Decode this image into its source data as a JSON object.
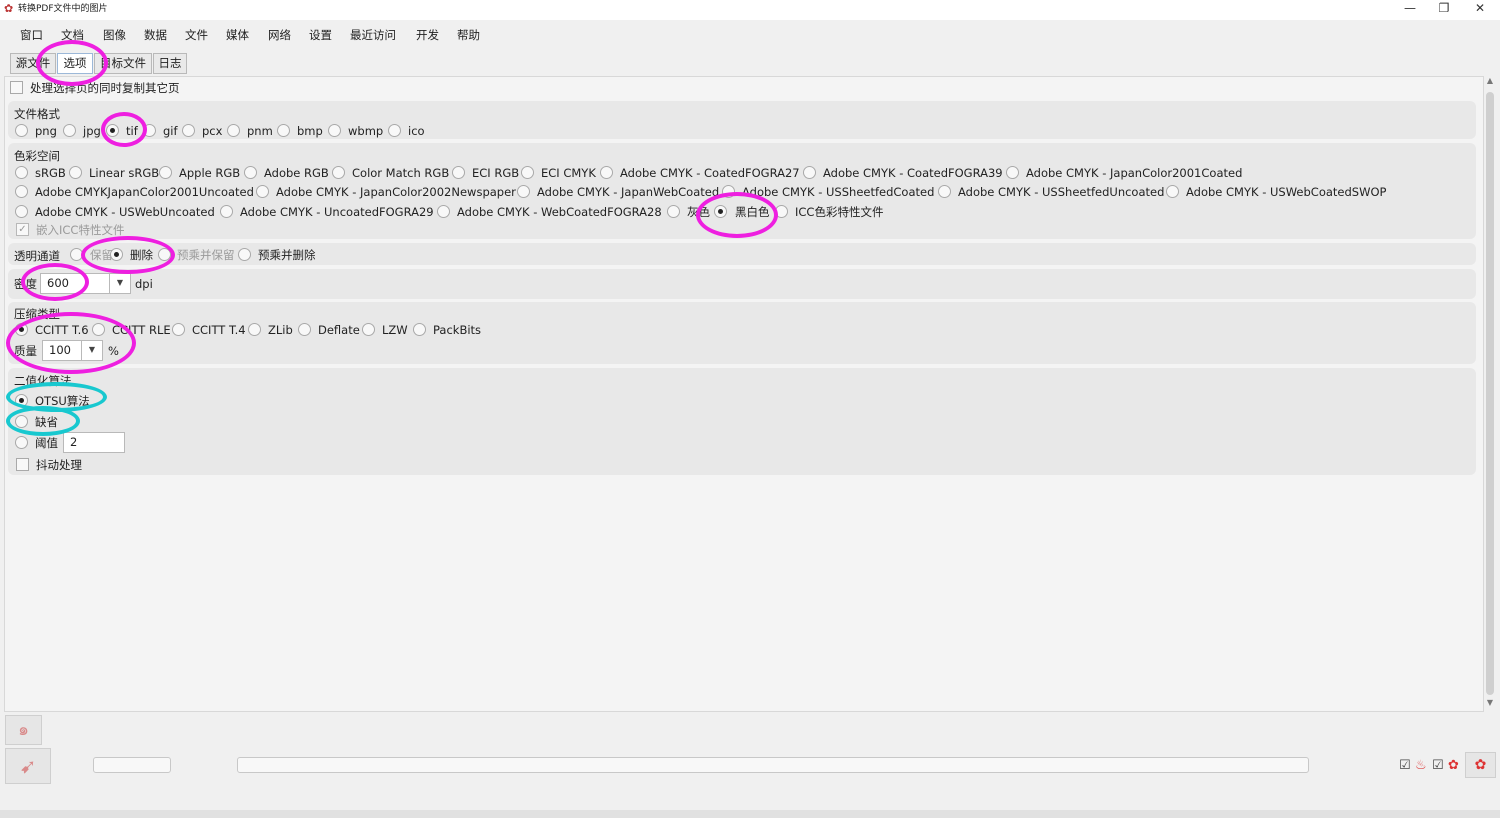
{
  "window": {
    "title": "转换PDF文件中的图片",
    "app_icon": "app-logo-icon",
    "controls": {
      "minimize": "—",
      "restore": "❐",
      "close": "✕"
    }
  },
  "menubar": [
    "窗口",
    "文档",
    "图像",
    "数据",
    "文件",
    "媒体",
    "网络",
    "设置",
    "最近访问",
    "开发",
    "帮助"
  ],
  "tabs": [
    "源文件",
    "选项",
    "目标文件",
    "日志"
  ],
  "active_tab": "选项",
  "options": {
    "copy_others": {
      "label": "处理选择页的同时复制其它页",
      "checked": false
    },
    "file_format": {
      "title": "文件格式",
      "options": [
        "png",
        "jpg",
        "tif",
        "gif",
        "pcx",
        "pnm",
        "bmp",
        "wbmp",
        "ico"
      ],
      "selected": "tif"
    },
    "color_space": {
      "title": "色彩空间",
      "row1": [
        "sRGB",
        "Linear sRGB",
        "Apple RGB",
        "Adobe RGB",
        "Color Match RGB",
        "ECI RGB",
        "ECI CMYK",
        "Adobe CMYK - CoatedFOGRA27",
        "Adobe CMYK - CoatedFOGRA39",
        "Adobe CMYK - JapanColor2001Coated"
      ],
      "row2": [
        "Adobe CMYKJapanColor2001Uncoated",
        "Adobe CMYK - JapanColor2002Newspaper",
        "Adobe CMYK - JapanWebCoated",
        "Adobe CMYK - USSheetfedCoated",
        "Adobe CMYK - USSheetfedUncoated",
        "Adobe CMYK - USWebCoatedSWOP"
      ],
      "row3": [
        "Adobe CMYK - USWebUncoated",
        "Adobe CMYK - UncoatedFOGRA29",
        "Adobe CMYK - WebCoatedFOGRA28",
        "灰色",
        "黑白色",
        "ICC色彩特性文件"
      ],
      "selected": "黑白色",
      "embed_icc": {
        "label": "嵌入ICC特性文件",
        "checked": true,
        "disabled": true
      }
    },
    "alpha": {
      "title": "透明通道",
      "options": [
        "保留",
        "删除",
        "预乘并保留",
        "预乘并删除"
      ],
      "selected": "删除"
    },
    "density": {
      "label": "密度",
      "value": "600",
      "unit": "dpi"
    },
    "compression": {
      "title": "压缩类型",
      "options": [
        "CCITT T.6",
        "CCITT RLE",
        "CCITT T.4",
        "ZLib",
        "Deflate",
        "LZW",
        "PackBits"
      ],
      "selected": "CCITT T.6",
      "quality_label": "质量",
      "quality_value": "100",
      "quality_unit": "%"
    },
    "binarization": {
      "title": "二值化算法",
      "otsu": "OTSU算法",
      "default": "缺省",
      "threshold_label": "阈值",
      "threshold_value": "2",
      "selected": "OTSU算法",
      "dithering": {
        "label": "抖动处理",
        "checked": false
      }
    }
  },
  "colors": {
    "annotation_magenta": "#ee1fe0",
    "annotation_cyan": "#18c8cf",
    "panel_bg": "#e8e8e8"
  },
  "tray_icons": [
    "checkmark-icon",
    "fire-icon",
    "checkmark-icon",
    "flower-icon",
    "flower-icon"
  ]
}
